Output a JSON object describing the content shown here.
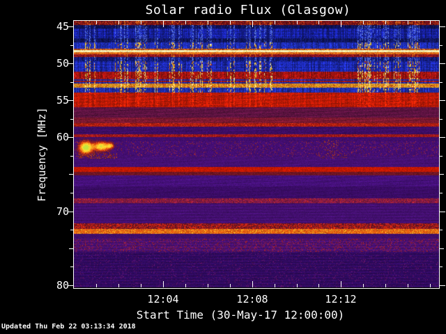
{
  "footer": {
    "updated": "Updated Thu Feb 22 03:13:34 2018"
  },
  "chart_data": {
    "type": "heatmap",
    "subtype": "solar-radio-spectrogram",
    "title": "Solar radio Flux (Glasgow)",
    "xlabel": "Start Time (30-May-17 12:00:00)",
    "ylabel": "Frequency [MHz]",
    "x_start_time": "12:00:00",
    "x_date": "30-May-17",
    "x_tick_labels": [
      "12:04",
      "12:08",
      "12:12"
    ],
    "x_tick_minutes": [
      4,
      8,
      12
    ],
    "x_minor_step_min": 1,
    "x_range_min": [
      0,
      16.4
    ],
    "y_tick_labels": [
      "45",
      "50",
      "55",
      "60",
      "70",
      "80"
    ],
    "y_tick_mhz": [
      45,
      50,
      55,
      60,
      70,
      80
    ],
    "y_minor_step_mhz": 2.5,
    "y_range_mhz": [
      44.25,
      80.3
    ],
    "legend": "none",
    "grid": false,
    "palette_hint": "dark blue/purple background, red interference bands, yellow-white saturated lines",
    "bands": [
      {
        "f0": 44.25,
        "f1": 44.8,
        "c": "#701016",
        "v": 0.3,
        "sp": [
          "#c03a10",
          0.2
        ],
        "st": "orange",
        "cv": 0.15
      },
      {
        "f0": 44.8,
        "f1": 45.3,
        "c": "#0d1258",
        "v": 0.35,
        "st": "blue",
        "cv": 0.2
      },
      {
        "f0": 45.3,
        "f1": 46.6,
        "c": "#16209c",
        "v": 0.28,
        "ra": 0.1,
        "st": "blue",
        "cv": 0.22
      },
      {
        "f0": 46.6,
        "f1": 47.15,
        "c": "#10165e",
        "v": 0.35,
        "st": "blue",
        "cv": 0.22
      },
      {
        "f0": 47.15,
        "f1": 48.0,
        "c": "#1e2eb6",
        "v": 0.28,
        "st": "yellow",
        "cv": 0.2
      },
      {
        "f0": 48.0,
        "f1": 48.2,
        "c": "#a33c12",
        "v": 0.3,
        "sp": [
          "#e07818",
          0.35
        ],
        "st": "orange"
      },
      {
        "f0": 48.2,
        "f1": 48.5,
        "c": "#f6f0bc",
        "v": 0.07,
        "sp": [
          "#ffdf7e",
          0.3
        ]
      },
      {
        "f0": 48.5,
        "f1": 48.8,
        "c": "#e2781a",
        "v": 0.2,
        "sp": [
          "#c03808",
          0.25
        ]
      },
      {
        "f0": 48.8,
        "f1": 49.15,
        "c": "#7c1020",
        "v": 0.3,
        "sp": [
          "#b02018",
          0.2
        ],
        "st": "orange"
      },
      {
        "f0": 49.15,
        "f1": 49.7,
        "c": "#121a74",
        "v": 0.35,
        "st": "blue",
        "cv": 0.22
      },
      {
        "f0": 49.7,
        "f1": 51.1,
        "c": "#1b28ac",
        "v": 0.28,
        "ra": 0.1,
        "st": "yellow",
        "cv": 0.22
      },
      {
        "f0": 51.1,
        "f1": 52.0,
        "c": "#a01410",
        "v": 0.3,
        "st": "yellow",
        "cv": 0.18
      },
      {
        "f0": 52.0,
        "f1": 52.7,
        "alt": [
          "#1c2aa8",
          "#a01818"
        ],
        "v": 0.3,
        "st": "yellow",
        "cv": 0.18
      },
      {
        "f0": 52.7,
        "f1": 53.3,
        "c": "#d89a22",
        "v": 0.22,
        "sp": [
          "#c04410",
          0.25
        ],
        "st": "gold"
      },
      {
        "f0": 53.3,
        "f1": 53.95,
        "c": "#1e2ca8",
        "v": 0.28,
        "st": "yellow",
        "cv": 0.2
      },
      {
        "f0": 53.95,
        "f1": 55.9,
        "c": "#bc1a06",
        "v": 0.2,
        "wv": 0.16,
        "st": "boost",
        "cv": 0.1
      },
      {
        "f0": 55.9,
        "f1": 57.3,
        "c": "#5c1340",
        "v": 0.2,
        "wv": 0.2
      },
      {
        "f0": 57.3,
        "f1": 58.1,
        "c": "#7c1830",
        "v": 0.22,
        "wv": 0.18
      },
      {
        "f0": 58.1,
        "f1": 58.55,
        "c": "#a81a10",
        "v": 0.25,
        "sp": [
          "#c83214",
          0.2
        ]
      },
      {
        "f0": 58.55,
        "f1": 59.6,
        "c": "#3c0d64",
        "v": 0.18,
        "wv": 0.12
      },
      {
        "f0": 59.6,
        "f1": 59.95,
        "c": "#96161a",
        "v": 0.28,
        "sp": [
          "#b62418",
          0.2
        ]
      },
      {
        "f0": 59.95,
        "f1": 60.5,
        "c": "#400d6c",
        "v": 0.15
      },
      {
        "f0": 60.5,
        "f1": 62.6,
        "c": "#440e72",
        "v": 0.15,
        "sp": [
          "#8c2430",
          0.08
        ]
      },
      {
        "f0": 62.6,
        "f1": 64.0,
        "c": "#451073",
        "v": 0.13,
        "wv": 0.1
      },
      {
        "f0": 64.0,
        "f1": 64.65,
        "c": "#c41800",
        "v": 0.18
      },
      {
        "f0": 64.65,
        "f1": 65.15,
        "c": "#6e1524",
        "v": 0.22
      },
      {
        "f0": 65.15,
        "f1": 66.65,
        "c": "#45107a",
        "v": 0.14,
        "wv": 0.14
      },
      {
        "f0": 66.65,
        "f1": 68.25,
        "c": "#3a0c66",
        "v": 0.14,
        "wv": 0.1
      },
      {
        "f0": 68.25,
        "f1": 68.9,
        "c": "#7a1846",
        "v": 0.25,
        "sp": [
          "#b02428",
          0.22
        ]
      },
      {
        "f0": 68.9,
        "f1": 71.65,
        "c": "#420f6e",
        "v": 0.13,
        "ra": 0.08,
        "wv": 0.08
      },
      {
        "f0": 71.65,
        "f1": 72.4,
        "c": "#6a1426",
        "v": 0.25,
        "sp": [
          "#c42410",
          0.45
        ]
      },
      {
        "f0": 72.4,
        "f1": 73.05,
        "c": "#e05c10",
        "v": 0.18,
        "sp": [
          "#f0a020",
          0.25
        ]
      },
      {
        "f0": 73.05,
        "f1": 73.7,
        "c": "#400e6a",
        "v": 0.14
      },
      {
        "f0": 73.7,
        "f1": 75.5,
        "c": "#471070",
        "v": 0.14,
        "ra": 0.1,
        "sp": [
          "#8c1c34",
          0.18
        ]
      },
      {
        "f0": 75.5,
        "f1": 80.3,
        "c": "#2f0a5e",
        "v": 0.13,
        "ra": 0.1,
        "wv": 0.1,
        "sp": [
          "#5c1260",
          0.08
        ]
      }
    ],
    "streak_clusters_min": [
      [
        0.45,
        0.95
      ],
      [
        1.8,
        2.45
      ],
      [
        2.75,
        3.25
      ],
      [
        3.6,
        3.95
      ],
      [
        4.3,
        4.85
      ],
      [
        5.2,
        5.75
      ],
      [
        5.95,
        6.2
      ],
      [
        6.8,
        7.3
      ],
      [
        7.7,
        8.4
      ],
      [
        8.55,
        8.9
      ],
      [
        12.75,
        13.6
      ],
      [
        13.75,
        14.1
      ],
      [
        14.35,
        14.65
      ],
      [
        15.0,
        15.5
      ]
    ],
    "burst": {
      "t_start_min": 0.3,
      "t_end_min": 1.8,
      "f_low_mhz": 60.4,
      "f_high_mhz": 62.6,
      "lobes": [
        {
          "t": 0.52,
          "f": 61.35,
          "rx": 9,
          "ry": 8.5,
          "a": 1.0
        },
        {
          "t": 1.22,
          "f": 61.2,
          "rx": 11,
          "ry": 6.5,
          "a": 0.82
        },
        {
          "t": 1.62,
          "f": 61.1,
          "rx": 5,
          "ry": 4.0,
          "a": 0.5
        }
      ]
    },
    "fuzz": [
      {
        "t0": 0.2,
        "t1": 1.9,
        "f0": 62.1,
        "f1": 62.9,
        "p": 0.3,
        "c": [
          "#b04014",
          "#902818"
        ]
      },
      {
        "t0": 11.2,
        "t1": 11.85,
        "f0": 60.3,
        "f1": 62.5,
        "p": 0.1,
        "c": [
          "#a03018",
          "#c04c14"
        ]
      },
      {
        "t0": 11.0,
        "t1": 12.3,
        "f0": 62.3,
        "f1": 62.9,
        "p": 0.12,
        "c": [
          "#983014"
        ]
      }
    ]
  }
}
